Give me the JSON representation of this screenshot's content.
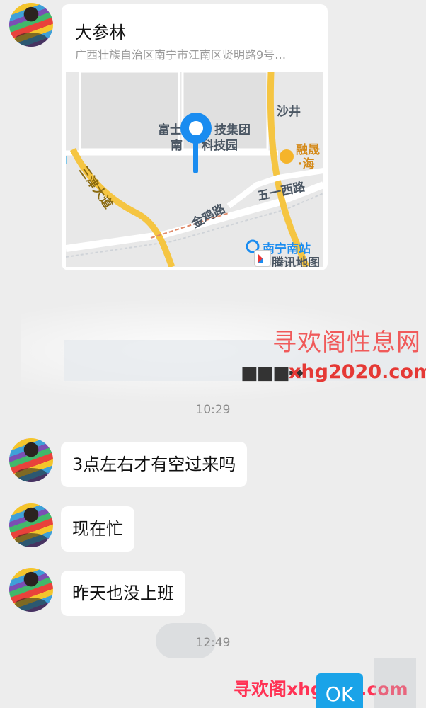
{
  "location": {
    "title": "大参林",
    "address": "广西壮族自治区南宁市江南区贤明路9号…",
    "map_labels": {
      "poi_1": "富士",
      "poi_1b": "技集团",
      "poi_2": "南",
      "poi_2b": "科技园",
      "shajing": "沙井",
      "rongsheng": "融晟",
      "haixin": "·海",
      "jinji_road": "金鸡路",
      "wuyi_road": "五一西路",
      "sanjin_road": "三津大道",
      "station": "南宁南站",
      "provider": "腾讯地图"
    }
  },
  "messages": [
    {
      "id": "time_1",
      "type": "time",
      "text": "10:29"
    },
    {
      "id": "msg_1",
      "type": "text",
      "text": "3点左右才有空过来吗"
    },
    {
      "id": "msg_2",
      "type": "text",
      "text": "现在忙"
    },
    {
      "id": "msg_3",
      "type": "text",
      "text": "昨天也没上班"
    },
    {
      "id": "time_2",
      "type": "time",
      "text": "12:49"
    }
  ],
  "watermarks": {
    "site_name": "寻欢阁性息网",
    "arrow": "■■■➡",
    "site_url": "xhg2020.com",
    "bottom_text": "寻欢阁xhg521.com",
    "ok_button": "OK"
  },
  "colors": {
    "background": "#ededed",
    "bubble": "#ffffff",
    "pin": "#1a8cf0",
    "road": "#f5c542"
  }
}
